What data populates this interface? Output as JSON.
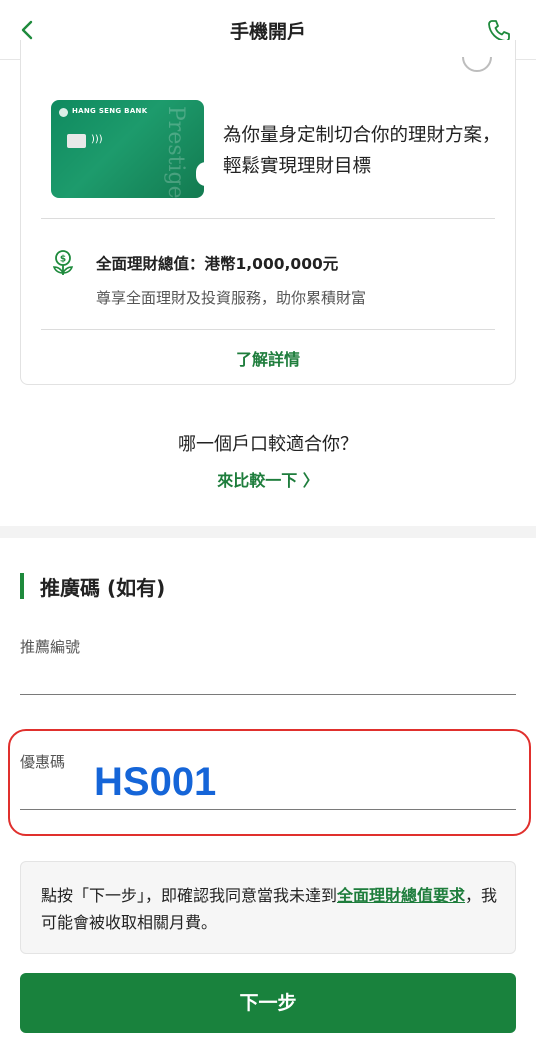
{
  "header": {
    "title": "手機開戶"
  },
  "account_card": {
    "bank_name": "HANG SENG BANK",
    "card_brand": "Prestige",
    "description": "為你量身定制切合你的理財方案，輕鬆實現理財目標",
    "feature_title": "全面理財總值：港幣1,000,000元",
    "feature_subtitle": "尊享全面理財及投資服務，助你累積財富",
    "learn_more_label": "了解詳情"
  },
  "compare": {
    "question": "哪一個戶口較適合你？",
    "link_label": "來比較一下 〉"
  },
  "referral": {
    "section_title": "推廣碼 (如有)",
    "referral_label": "推薦編號",
    "referral_value": "",
    "promo_label": "優惠碼",
    "promo_value": "HS001"
  },
  "notice": {
    "text_before": "點按「下一步」，即確認我同意當我未達到",
    "link_text": "全面理財總值要求",
    "text_after": "，我可能會被收取相關月費。"
  },
  "footer": {
    "next_label": "下一步"
  },
  "colors": {
    "brand_green": "#19823d",
    "link_green": "#1e7d3c",
    "promo_blue": "#1565d8",
    "highlight_red": "#e0302d"
  }
}
